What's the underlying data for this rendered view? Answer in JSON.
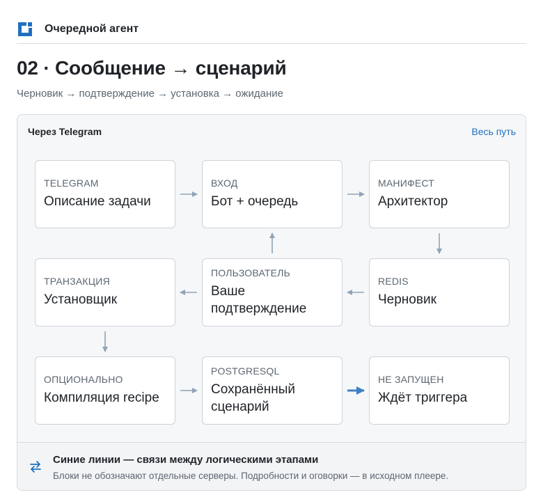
{
  "app": {
    "title": "Очередной агент"
  },
  "page": {
    "title": "02 · Сообщение → сценарий",
    "subtitle": "Черновик → подтверждение → установка → ожидание"
  },
  "panel": {
    "heading": "Через Telegram",
    "link_label": "Весь путь"
  },
  "nodes": [
    {
      "id": "telegram",
      "tag": "TELEGRAM",
      "label": "Описание задачи"
    },
    {
      "id": "entry",
      "tag": "ВХОД",
      "label": "Бот + очередь"
    },
    {
      "id": "manifest",
      "tag": "МАНИФЕСТ",
      "label": "Архитектор"
    },
    {
      "id": "transaction",
      "tag": "ТРАНЗАКЦИЯ",
      "label": "Установщик"
    },
    {
      "id": "user",
      "tag": "ПОЛЬЗОВАТЕЛЬ",
      "label": "Ваше подтверждение"
    },
    {
      "id": "redis",
      "tag": "REDIS",
      "label": "Черновик"
    },
    {
      "id": "optional",
      "tag": "ОПЦИОНАЛЬНО",
      "label": "Компиляция recipe"
    },
    {
      "id": "postgres",
      "tag": "POSTGRESQL",
      "label": "Сохранённый сценарий"
    },
    {
      "id": "not-started",
      "tag": "НЕ ЗАПУЩЕН",
      "label": "Ждёт триггера"
    }
  ],
  "edges": [
    {
      "from": "telegram",
      "to": "entry",
      "style": "normal"
    },
    {
      "from": "entry",
      "to": "manifest",
      "style": "normal"
    },
    {
      "from": "manifest",
      "to": "redis",
      "style": "normal"
    },
    {
      "from": "redis",
      "to": "user",
      "style": "normal"
    },
    {
      "from": "user",
      "to": "entry",
      "style": "normal"
    },
    {
      "from": "user",
      "to": "transaction",
      "style": "normal"
    },
    {
      "from": "transaction",
      "to": "optional",
      "style": "normal"
    },
    {
      "from": "optional",
      "to": "postgres",
      "style": "normal"
    },
    {
      "from": "postgres",
      "to": "not-started",
      "style": "emphasis"
    }
  ],
  "legend": {
    "icon": "swap-arrows-icon",
    "title": "Синие линии — связи между логическими этапами",
    "text": "Блоки не обозначают отдельные серверы. Подробности и оговорки — в исходном плеере."
  },
  "colors": {
    "link": "#1f6fbf",
    "arrow": "#8fa3b8",
    "arrow_emphasis": "#3f7fc4",
    "logo": "#1f6fbf"
  }
}
